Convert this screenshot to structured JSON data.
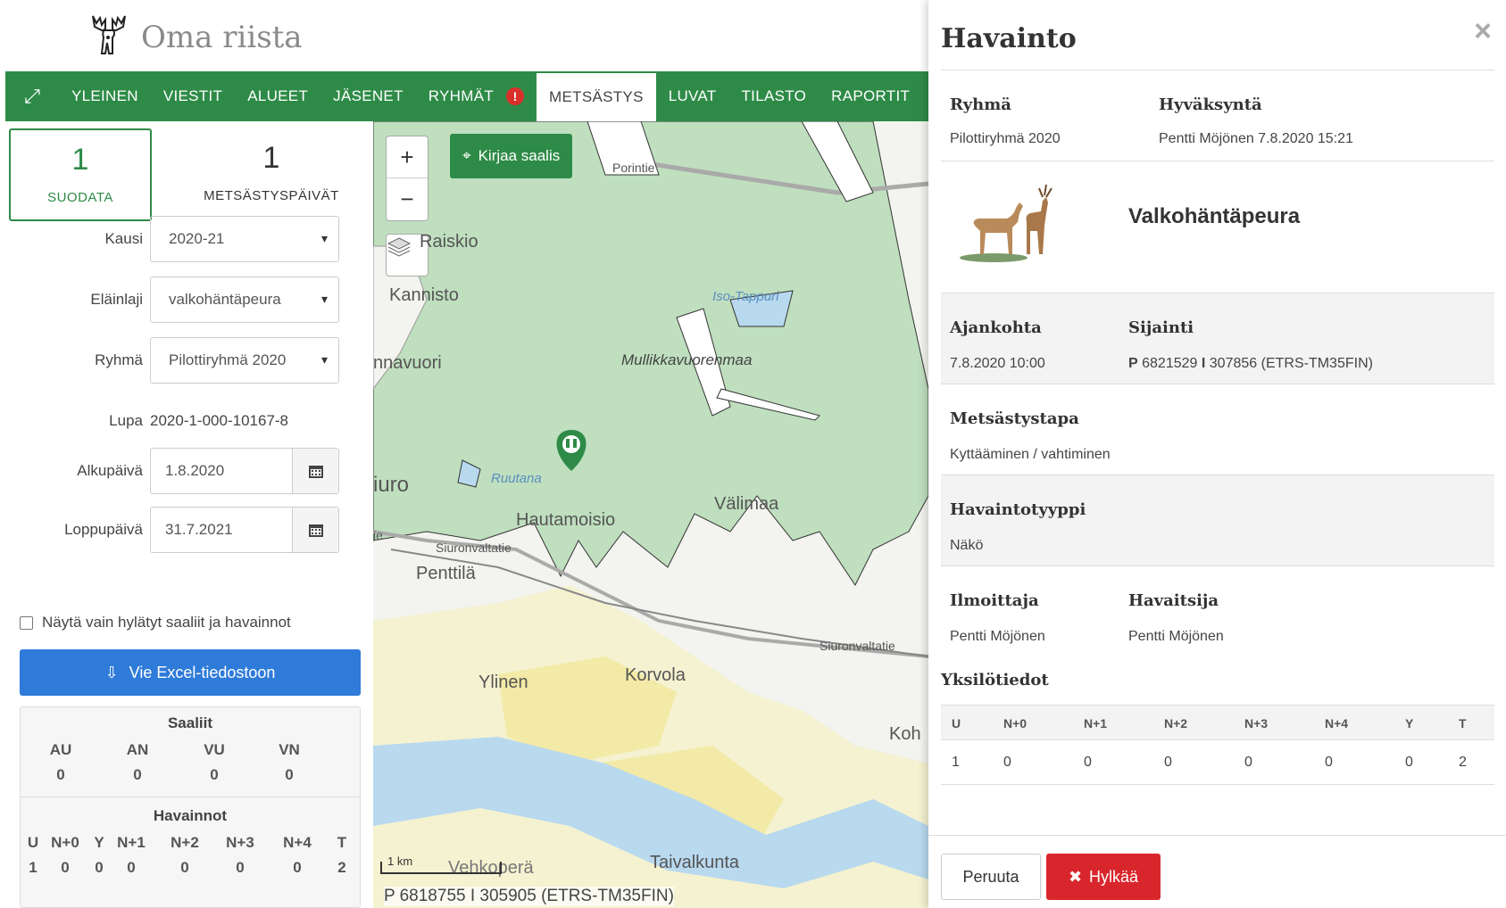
{
  "header": {
    "brand": "Oma riista",
    "logo_icon": "moose-logo-icon"
  },
  "nav": {
    "expand_icon": "expand-icon",
    "items": [
      {
        "label": "YLEINEN"
      },
      {
        "label": "VIESTIT"
      },
      {
        "label": "ALUEET"
      },
      {
        "label": "JÄSENET"
      },
      {
        "label": "RYHMÄT",
        "alert": "!"
      },
      {
        "label": "METSÄSTYS",
        "active": true
      },
      {
        "label": "LUVAT"
      },
      {
        "label": "TILASTO"
      },
      {
        "label": "RAPORTIT"
      }
    ]
  },
  "left": {
    "tabs": [
      {
        "count": "1",
        "label": "SUODATA"
      },
      {
        "count": "1",
        "label": "METSÄSTYSPÄIVÄT"
      }
    ],
    "filters": {
      "kausi": {
        "label": "Kausi",
        "value": "2020-21"
      },
      "elainlaji": {
        "label": "Eläinlaji",
        "value": "valkohäntäpeura"
      },
      "ryhma": {
        "label": "Ryhmä",
        "value": "Pilottiryhmä 2020"
      },
      "lupa": {
        "label": "Lupa",
        "value": "2020-1-000-10167-8"
      },
      "alkupaiva": {
        "label": "Alkupäivä",
        "value": "1.8.2020"
      },
      "loppupaiva": {
        "label": "Loppupäivä",
        "value": "31.7.2021"
      }
    },
    "checkbox_label": "Näytä vain hylätyt saaliit ja havainnot",
    "excel_button": "Vie Excel-tiedostoon",
    "saaliit": {
      "title": "Saaliit",
      "cols": [
        {
          "h": "AU",
          "v": "0"
        },
        {
          "h": "AN",
          "v": "0"
        },
        {
          "h": "VU",
          "v": "0"
        },
        {
          "h": "VN",
          "v": "0"
        }
      ]
    },
    "havainnot": {
      "title": "Havainnot",
      "cols": [
        {
          "h": "U",
          "v": "1"
        },
        {
          "h": "N+0",
          "v": "0"
        },
        {
          "h": "Y",
          "v": "0"
        },
        {
          "h": "N+1",
          "v": "0"
        },
        {
          "h": "N+2",
          "v": "0"
        },
        {
          "h": "N+3",
          "v": "0"
        },
        {
          "h": "N+4",
          "v": "0"
        },
        {
          "h": "T",
          "v": "2"
        }
      ]
    }
  },
  "map": {
    "zoom_in": "+",
    "zoom_out": "−",
    "kirjaa_button": "Kirjaa saalis",
    "labels": {
      "raiskio": "Raiskio",
      "kannisto": "Kannisto",
      "nnavuori": "nnavuori",
      "iuro": "iuro",
      "mullikka": "Mullikkavuorenmaa",
      "isotappuri": "Iso-Tappuri",
      "ruutana": "Ruutana",
      "hautamoisio": "Hautamoisio",
      "valimaa": "Välimaa",
      "porintie": "Porintie",
      "siuron1": "Siuronvaltatie",
      "siuron2": "Siuronvaltatie",
      "penttila": "Penttilä",
      "ylinen": "Ylinen",
      "korvola": "Korvola",
      "koh": "Koh",
      "vehkopera": "Vehkoperä",
      "taivalkunta": "Taivalkunta",
      "ie": "ie"
    },
    "scale_label": "1 km",
    "coordinates": "P 6818755 I 305905 (ETRS-TM35FIN)"
  },
  "modal": {
    "title": "Havainto",
    "close": "×",
    "ryhma": {
      "label": "Ryhmä",
      "value": "Pilottiryhmä 2020"
    },
    "hyvaksynta": {
      "label": "Hyväksyntä",
      "value": "Pentti Möjönen 7.8.2020 15:21"
    },
    "species": "Valkohäntäpeura",
    "ajankohta": {
      "label": "Ajankohta",
      "value": "7.8.2020 10:00"
    },
    "sijainti": {
      "label": "Sijainti",
      "p": "P",
      "value": "6821529",
      "sep": "I",
      "value2": "307856 (ETRS-TM35FIN)"
    },
    "metsastystapa": {
      "label": "Metsästystapa",
      "value": "Kyttääminen / vahtiminen"
    },
    "havaintotyyppi": {
      "label": "Havaintotyyppi",
      "value": "Näkö"
    },
    "ilmoittaja": {
      "label": "Ilmoittaja",
      "value": "Pentti Möjönen"
    },
    "havaitsija": {
      "label": "Havaitsija",
      "value": "Pentti Möjönen"
    },
    "yksilotiedot": {
      "title": "Yksilötiedot",
      "headers": [
        "U",
        "N+0",
        "N+1",
        "N+2",
        "N+3",
        "N+4",
        "Y",
        "T"
      ],
      "values": [
        "1",
        "0",
        "0",
        "0",
        "0",
        "0",
        "0",
        "2"
      ]
    },
    "cancel_button": "Peruuta",
    "reject_button": "Hylkää"
  },
  "colors": {
    "brand_green": "#2e8b47",
    "primary_blue": "#2f7bd9",
    "danger_red": "#d9262c",
    "map_green": "#bfdfbf"
  }
}
